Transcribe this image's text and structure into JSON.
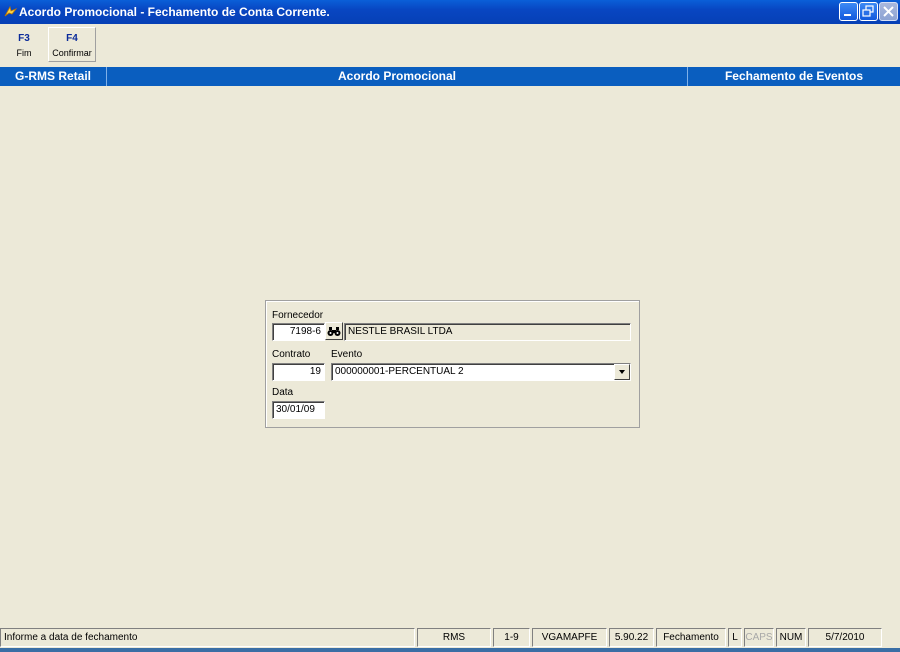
{
  "window": {
    "title": "Acordo Promocional - Fechamento de Conta Corrente.",
    "icon": "app-icon",
    "controls": [
      "minimize-icon",
      "restore-icon",
      "close-icon"
    ]
  },
  "toolbar": {
    "items": [
      {
        "key": "F3",
        "label": "Fim"
      },
      {
        "key": "F4",
        "label": "Confirmar"
      }
    ]
  },
  "header": {
    "left": "G-RMS Retail",
    "center": "Acordo Promocional",
    "right": "Fechamento de Eventos"
  },
  "form": {
    "fornecedor_label": "Fornecedor",
    "fornecedor_code": "7198-6",
    "fornecedor_name": "NESTLE BRASIL LTDA",
    "search_icon": "binoculars-icon",
    "contrato_label": "Contrato",
    "contrato_value": "19",
    "evento_label": "Evento",
    "evento_value": "000000001-PERCENTUAL 2",
    "data_label": "Data",
    "data_value": "30/01/09"
  },
  "statusbar": {
    "message": "Informe a data de fechamento",
    "system": "RMS",
    "range": "1-9",
    "program": "VGAMAPFE",
    "version": "5.90.22",
    "mode": "Fechamento",
    "lock": "L",
    "caps": "CAPS",
    "num": "NUM",
    "date": "5/7/2010"
  },
  "colors": {
    "titlebar": "#0846c2",
    "header_band": "#0a5ebf",
    "background": "#ece9d8",
    "toolbar_key": "#0a2a9a"
  }
}
